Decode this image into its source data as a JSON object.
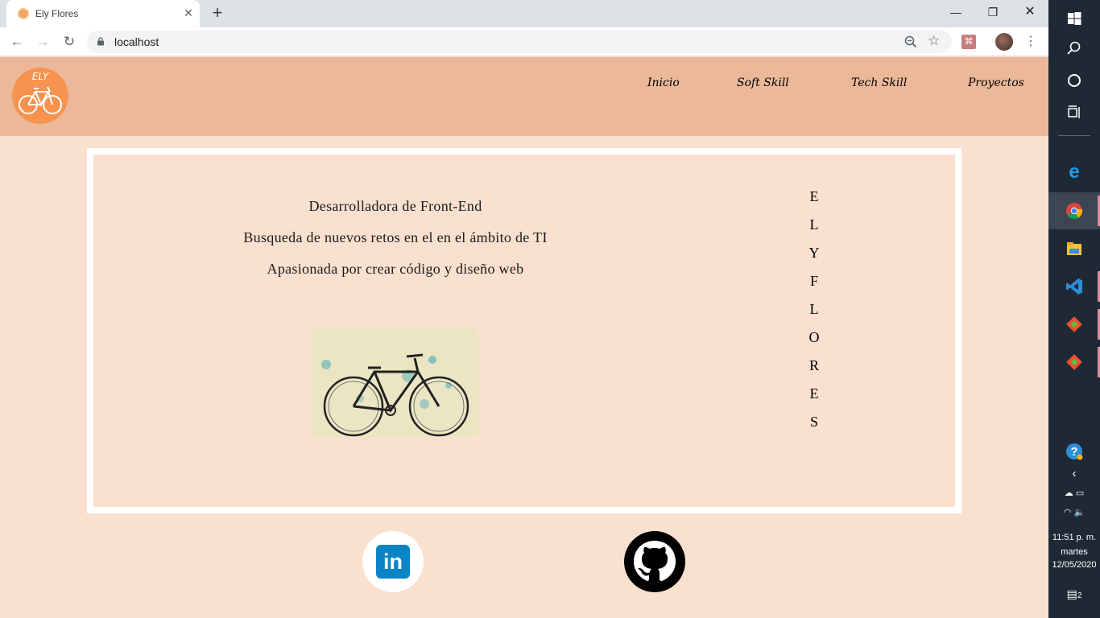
{
  "browser": {
    "tab_title": "Ely Flores",
    "url": "localhost",
    "new_tab_symbol": "+",
    "window_controls": {
      "minimize": "—",
      "maximize": "❐",
      "close": "✕"
    }
  },
  "site": {
    "logo_text": "ELY",
    "nav": {
      "inicio": "Inicio",
      "soft_skill": "Soft Skill",
      "tech_skill": "Tech Skill",
      "proyectos": "Proyectos"
    },
    "taglines": [
      "Desarrolladora de Front-End",
      "Busqueda de nuevos retos en el en el ámbito de TI",
      "Apasionada por crear código y diseño web"
    ],
    "vertical_name": [
      "E",
      "L",
      "Y",
      "F",
      "L",
      "O",
      "R",
      "E",
      "S"
    ],
    "social": {
      "linkedin_text": "in"
    },
    "colors": {
      "header_bg": "#ebb899",
      "page_bg": "#fae0cf",
      "logo_bg": "#f7924f",
      "linkedin_blue": "#0a84c6"
    }
  },
  "taskbar": {
    "icons": [
      "windows-start-icon",
      "search-icon",
      "cortana-icon",
      "task-view-icon",
      "edge-icon",
      "chrome-icon",
      "file-explorer-icon",
      "vscode-icon",
      "git-icon",
      "git-icon",
      "help-icon"
    ],
    "time": "11:51 p. m.",
    "day": "martes",
    "date": "12/05/2020",
    "notification_count": "2"
  }
}
